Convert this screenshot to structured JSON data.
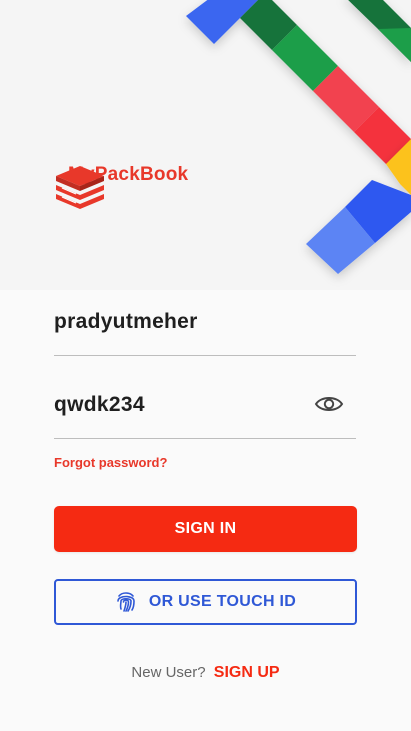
{
  "brand": {
    "name": "MyPackBook",
    "color": "#e8382a"
  },
  "login": {
    "username_value": "pradyutmeher",
    "password_value": "qwdk234",
    "forgot_label": "Forgot password?",
    "signin_label": "SIGN IN",
    "touch_id_label": "OR USE TOUCH ID",
    "new_user_label": "New User?",
    "signup_label": "SIGN UP"
  },
  "icons": {
    "password_toggle": "eye-icon",
    "touch_id": "fingerprint-icon",
    "logo": "stacked-books-logo"
  },
  "colors": {
    "primary": "#f52a12",
    "secondary": "#2f58d6",
    "ribbon_blue": "#3b66f0",
    "ribbon_green": "#1e9e4a",
    "ribbon_red": "#f2434f",
    "ribbon_yellow": "#fcc21b"
  }
}
